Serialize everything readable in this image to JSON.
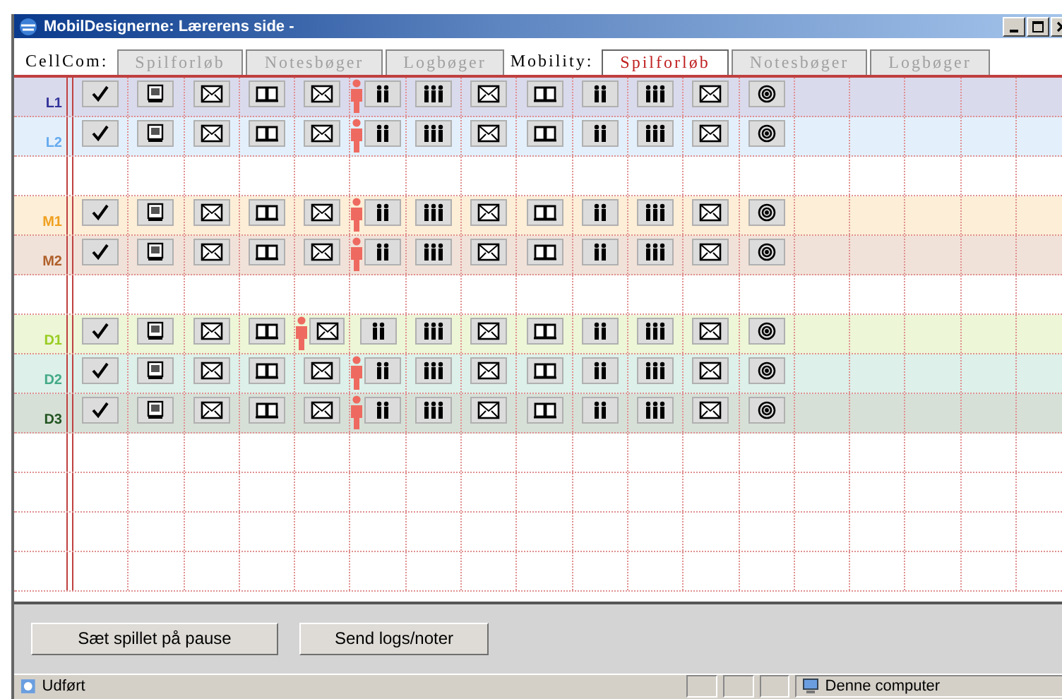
{
  "window": {
    "title": "MobilDesignerne: Lærerens side -"
  },
  "tab_groups": [
    {
      "label": "CellCom:",
      "tabs": [
        {
          "label": "Spilforløb",
          "selected": false
        },
        {
          "label": "Notesbøger",
          "selected": false
        },
        {
          "label": "Logbøger",
          "selected": false
        }
      ]
    },
    {
      "label": "Mobility:",
      "tabs": [
        {
          "label": "Spilforløb",
          "selected": true
        },
        {
          "label": "Notesbøger",
          "selected": false
        },
        {
          "label": "Logbøger",
          "selected": false
        }
      ]
    }
  ],
  "rows": [
    {
      "kind": "team",
      "label": "L1",
      "color": "#333399",
      "cells": [
        {
          "kind": "check",
          "marked": false
        },
        {
          "kind": "tv",
          "marked": false
        },
        {
          "kind": "mail",
          "marked": false
        },
        {
          "kind": "book",
          "marked": false
        },
        {
          "kind": "mail",
          "marked": false
        },
        {
          "kind": "pair",
          "marked": true
        },
        {
          "kind": "trio",
          "marked": false
        },
        {
          "kind": "mail",
          "marked": false
        },
        {
          "kind": "book",
          "marked": false
        },
        {
          "kind": "pair",
          "marked": false
        },
        {
          "kind": "trio",
          "marked": false
        },
        {
          "kind": "mail",
          "marked": false
        },
        {
          "kind": "target",
          "marked": false
        }
      ]
    },
    {
      "kind": "team",
      "label": "L2",
      "color": "#66aaee",
      "cells": [
        {
          "kind": "check",
          "marked": false
        },
        {
          "kind": "tv",
          "marked": false
        },
        {
          "kind": "mail",
          "marked": false
        },
        {
          "kind": "book",
          "marked": false
        },
        {
          "kind": "mail",
          "marked": false
        },
        {
          "kind": "pair",
          "marked": true
        },
        {
          "kind": "trio",
          "marked": false
        },
        {
          "kind": "mail",
          "marked": false
        },
        {
          "kind": "book",
          "marked": false
        },
        {
          "kind": "pair",
          "marked": false
        },
        {
          "kind": "trio",
          "marked": false
        },
        {
          "kind": "mail",
          "marked": false
        },
        {
          "kind": "target",
          "marked": false
        }
      ]
    },
    {
      "kind": "blank"
    },
    {
      "kind": "team",
      "label": "M1",
      "color": "#f0a020",
      "cells": [
        {
          "kind": "check",
          "marked": false
        },
        {
          "kind": "tv",
          "marked": false
        },
        {
          "kind": "mail",
          "marked": false
        },
        {
          "kind": "book",
          "marked": false
        },
        {
          "kind": "mail",
          "marked": false
        },
        {
          "kind": "pair",
          "marked": true
        },
        {
          "kind": "trio",
          "marked": false
        },
        {
          "kind": "mail",
          "marked": false
        },
        {
          "kind": "book",
          "marked": false
        },
        {
          "kind": "pair",
          "marked": false
        },
        {
          "kind": "trio",
          "marked": false
        },
        {
          "kind": "mail",
          "marked": false
        },
        {
          "kind": "target",
          "marked": false
        }
      ]
    },
    {
      "kind": "team",
      "label": "M2",
      "color": "#b0602a",
      "cells": [
        {
          "kind": "check",
          "marked": false
        },
        {
          "kind": "tv",
          "marked": false
        },
        {
          "kind": "mail",
          "marked": false
        },
        {
          "kind": "book",
          "marked": false
        },
        {
          "kind": "mail",
          "marked": false
        },
        {
          "kind": "pair",
          "marked": true
        },
        {
          "kind": "trio",
          "marked": false
        },
        {
          "kind": "mail",
          "marked": false
        },
        {
          "kind": "book",
          "marked": false
        },
        {
          "kind": "pair",
          "marked": false
        },
        {
          "kind": "trio",
          "marked": false
        },
        {
          "kind": "mail",
          "marked": false
        },
        {
          "kind": "target",
          "marked": false
        }
      ]
    },
    {
      "kind": "blank"
    },
    {
      "kind": "team",
      "label": "D1",
      "color": "#99cc22",
      "cells": [
        {
          "kind": "check",
          "marked": false
        },
        {
          "kind": "tv",
          "marked": false
        },
        {
          "kind": "mail",
          "marked": false
        },
        {
          "kind": "book",
          "marked": false
        },
        {
          "kind": "mail",
          "marked": true
        },
        {
          "kind": "pair",
          "marked": false
        },
        {
          "kind": "trio",
          "marked": false
        },
        {
          "kind": "mail",
          "marked": false
        },
        {
          "kind": "book",
          "marked": false
        },
        {
          "kind": "pair",
          "marked": false
        },
        {
          "kind": "trio",
          "marked": false
        },
        {
          "kind": "mail",
          "marked": false
        },
        {
          "kind": "target",
          "marked": false
        }
      ]
    },
    {
      "kind": "team",
      "label": "D2",
      "color": "#44aa88",
      "cells": [
        {
          "kind": "check",
          "marked": false
        },
        {
          "kind": "tv",
          "marked": false
        },
        {
          "kind": "mail",
          "marked": false
        },
        {
          "kind": "book",
          "marked": false
        },
        {
          "kind": "mail",
          "marked": false
        },
        {
          "kind": "pair",
          "marked": true
        },
        {
          "kind": "trio",
          "marked": false
        },
        {
          "kind": "mail",
          "marked": false
        },
        {
          "kind": "book",
          "marked": false
        },
        {
          "kind": "pair",
          "marked": false
        },
        {
          "kind": "trio",
          "marked": false
        },
        {
          "kind": "mail",
          "marked": false
        },
        {
          "kind": "target",
          "marked": false
        }
      ]
    },
    {
      "kind": "team",
      "label": "D3",
      "color": "#225522",
      "cells": [
        {
          "kind": "check",
          "marked": false
        },
        {
          "kind": "tv",
          "marked": false
        },
        {
          "kind": "mail",
          "marked": false
        },
        {
          "kind": "book",
          "marked": false
        },
        {
          "kind": "mail",
          "marked": false
        },
        {
          "kind": "pair",
          "marked": true
        },
        {
          "kind": "trio",
          "marked": false
        },
        {
          "kind": "mail",
          "marked": false
        },
        {
          "kind": "book",
          "marked": false
        },
        {
          "kind": "pair",
          "marked": false
        },
        {
          "kind": "trio",
          "marked": false
        },
        {
          "kind": "mail",
          "marked": false
        },
        {
          "kind": "target",
          "marked": false
        }
      ]
    },
    {
      "kind": "blank"
    },
    {
      "kind": "blank"
    },
    {
      "kind": "blank"
    },
    {
      "kind": "blank"
    }
  ],
  "buttons": [
    "Sæt spillet på pause",
    "Send logs/noter"
  ],
  "status_bar": {
    "left": "Udført",
    "right": "Denne computer"
  }
}
